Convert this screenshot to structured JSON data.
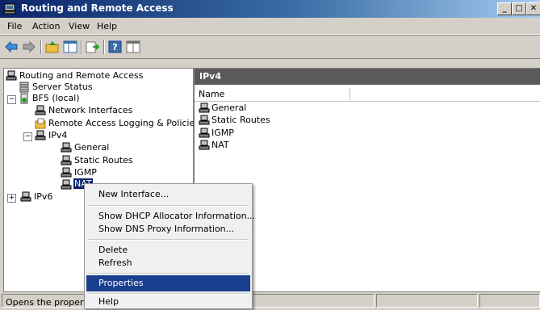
{
  "window": {
    "title": "Routing and Remote Access",
    "controls": [
      "_",
      "□",
      "✕"
    ]
  },
  "menu": [
    "File",
    "Action",
    "View",
    "Help"
  ],
  "tree": {
    "root": "Routing and Remote Access",
    "server_status": "Server Status",
    "server": "BF5 (local)",
    "network_interfaces": "Network Interfaces",
    "remote_access_logging": "Remote Access Logging & Policies",
    "ipv4": "IPv4",
    "ipv4_children": [
      "General",
      "Static Routes",
      "IGMP",
      "NAT"
    ],
    "ipv6": "IPv6",
    "expander_expanded": "−",
    "expander_collapsed": "+"
  },
  "details": {
    "header": "IPv4",
    "column_name": "Name",
    "items": [
      "General",
      "Static Routes",
      "IGMP",
      "NAT"
    ]
  },
  "context_menu": {
    "new_interface": "New Interface...",
    "show_dhcp": "Show DHCP Allocator Information...",
    "show_dns": "Show DNS Proxy Information...",
    "delete": "Delete",
    "refresh": "Refresh",
    "properties": "Properties",
    "help": "Help"
  },
  "status_bar": {
    "text": "Opens the propertie"
  }
}
